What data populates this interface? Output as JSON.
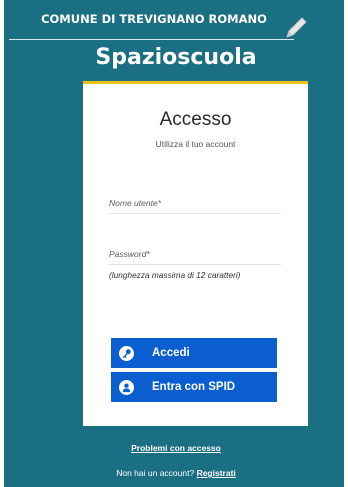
{
  "header": {
    "municipality": "COMUNE DI TREVIGNANO ROMANO",
    "app_title": "Spazioscuola"
  },
  "login": {
    "title": "Accesso",
    "subtitle": "Utilizza il tuo account",
    "username_placeholder": "Nome utente*",
    "password_placeholder": "Password*",
    "password_hint": "(lunghezza massima di 12 caratteri)",
    "login_button": "Accedi",
    "spid_button": "Entra con SPID"
  },
  "footer": {
    "problems_link": "Problemi con accesso",
    "no_account_text": "Non hai un account?",
    "register_link": "Registrati"
  },
  "colors": {
    "background": "#1b6f83",
    "accent": "#e8c21a",
    "button": "#0a5ecf"
  },
  "icons": [
    "pencil-icon",
    "key-icon",
    "user-icon"
  ]
}
